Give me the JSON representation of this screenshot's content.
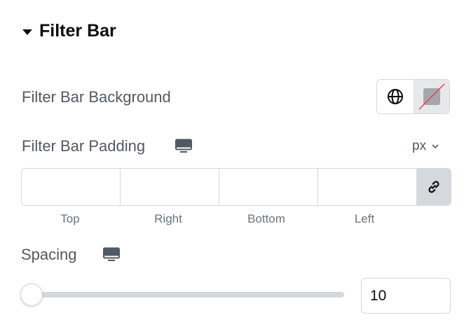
{
  "section": {
    "title": "Filter Bar",
    "expanded": true
  },
  "background": {
    "label": "Filter Bar Background",
    "icons": {
      "global": "globe-icon",
      "swatch": "no-color-swatch-icon"
    }
  },
  "padding": {
    "label": "Filter Bar Padding",
    "device_icon": "desktop-icon",
    "unit": "px",
    "fields": [
      {
        "label": "Top",
        "value": ""
      },
      {
        "label": "Right",
        "value": ""
      },
      {
        "label": "Bottom",
        "value": ""
      },
      {
        "label": "Left",
        "value": ""
      }
    ],
    "link_icon": "link-icon"
  },
  "spacing": {
    "label": "Spacing",
    "device_icon": "desktop-icon",
    "value": "10",
    "slider_fraction": 0
  },
  "colors": {
    "title": "#0c0d0e",
    "label": "#515962",
    "border": "#d5d8dc",
    "no_color_slash": "#e2454a"
  }
}
